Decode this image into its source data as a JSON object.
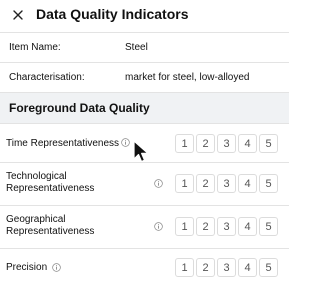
{
  "header": {
    "title": "Data Quality Indicators",
    "close_icon": "close-icon"
  },
  "info": [
    {
      "label": "Item Name:",
      "value": "Steel"
    },
    {
      "label": "Characterisation:",
      "value": "market for steel, low-alloyed"
    }
  ],
  "section": {
    "title": "Foreground Data Quality"
  },
  "indicators": [
    {
      "label": "Time Representativeness",
      "scores": [
        "1",
        "2",
        "3",
        "4",
        "5"
      ]
    },
    {
      "label": "Technological Representativeness",
      "scores": [
        "1",
        "2",
        "3",
        "4",
        "5"
      ]
    },
    {
      "label": "Geographical Representativeness",
      "scores": [
        "1",
        "2",
        "3",
        "4",
        "5"
      ]
    },
    {
      "label": "Precision",
      "scores": [
        "1",
        "2",
        "3",
        "4",
        "5"
      ]
    }
  ],
  "colors": {
    "section_bg": "#f0f2f4",
    "border": "#e3e3e3",
    "text": "#111111",
    "score_text": "#555555"
  }
}
